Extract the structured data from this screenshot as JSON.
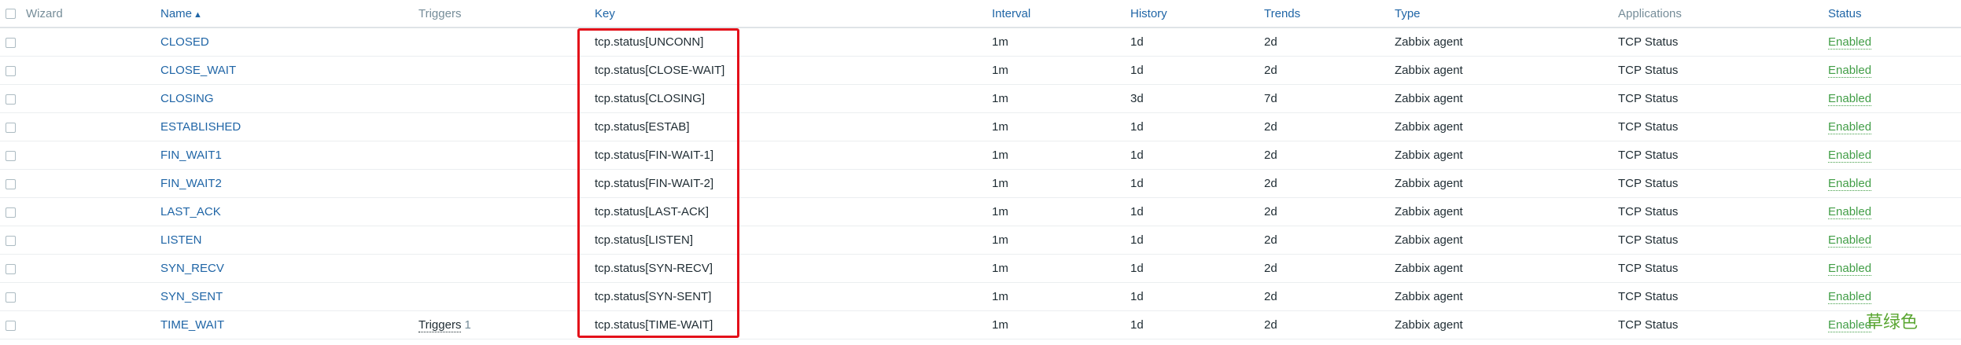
{
  "headers": {
    "wizard": "Wizard",
    "name": "Name",
    "name_sort_indicator": "▲",
    "triggers": "Triggers",
    "key": "Key",
    "interval": "Interval",
    "history": "History",
    "trends": "Trends",
    "type": "Type",
    "applications": "Applications",
    "status": "Status"
  },
  "rows": [
    {
      "name": "CLOSED",
      "triggers": "",
      "triggers_count": "",
      "key": "tcp.status[UNCONN]",
      "interval": "1m",
      "history": "1d",
      "trends": "2d",
      "type": "Zabbix agent",
      "applications": "TCP Status",
      "status": "Enabled"
    },
    {
      "name": "CLOSE_WAIT",
      "triggers": "",
      "triggers_count": "",
      "key": "tcp.status[CLOSE-WAIT]",
      "interval": "1m",
      "history": "1d",
      "trends": "2d",
      "type": "Zabbix agent",
      "applications": "TCP Status",
      "status": "Enabled"
    },
    {
      "name": "CLOSING",
      "triggers": "",
      "triggers_count": "",
      "key": "tcp.status[CLOSING]",
      "interval": "1m",
      "history": "3d",
      "trends": "7d",
      "type": "Zabbix agent",
      "applications": "TCP Status",
      "status": "Enabled"
    },
    {
      "name": "ESTABLISHED",
      "triggers": "",
      "triggers_count": "",
      "key": "tcp.status[ESTAB]",
      "interval": "1m",
      "history": "1d",
      "trends": "2d",
      "type": "Zabbix agent",
      "applications": "TCP Status",
      "status": "Enabled"
    },
    {
      "name": "FIN_WAIT1",
      "triggers": "",
      "triggers_count": "",
      "key": "tcp.status[FIN-WAIT-1]",
      "interval": "1m",
      "history": "1d",
      "trends": "2d",
      "type": "Zabbix agent",
      "applications": "TCP Status",
      "status": "Enabled"
    },
    {
      "name": "FIN_WAIT2",
      "triggers": "",
      "triggers_count": "",
      "key": "tcp.status[FIN-WAIT-2]",
      "interval": "1m",
      "history": "1d",
      "trends": "2d",
      "type": "Zabbix agent",
      "applications": "TCP Status",
      "status": "Enabled"
    },
    {
      "name": "LAST_ACK",
      "triggers": "",
      "triggers_count": "",
      "key": "tcp.status[LAST-ACK]",
      "interval": "1m",
      "history": "1d",
      "trends": "2d",
      "type": "Zabbix agent",
      "applications": "TCP Status",
      "status": "Enabled"
    },
    {
      "name": "LISTEN",
      "triggers": "",
      "triggers_count": "",
      "key": "tcp.status[LISTEN]",
      "interval": "1m",
      "history": "1d",
      "trends": "2d",
      "type": "Zabbix agent",
      "applications": "TCP Status",
      "status": "Enabled"
    },
    {
      "name": "SYN_RECV",
      "triggers": "",
      "triggers_count": "",
      "key": "tcp.status[SYN-RECV]",
      "interval": "1m",
      "history": "1d",
      "trends": "2d",
      "type": "Zabbix agent",
      "applications": "TCP Status",
      "status": "Enabled"
    },
    {
      "name": "SYN_SENT",
      "triggers": "",
      "triggers_count": "",
      "key": "tcp.status[SYN-SENT]",
      "interval": "1m",
      "history": "1d",
      "trends": "2d",
      "type": "Zabbix agent",
      "applications": "TCP Status",
      "status": "Enabled"
    },
    {
      "name": "TIME_WAIT",
      "triggers": "Triggers",
      "triggers_count": "1",
      "key": "tcp.status[TIME-WAIT]",
      "interval": "1m",
      "history": "1d",
      "trends": "2d",
      "type": "Zabbix agent",
      "applications": "TCP Status",
      "status": "Enabled"
    }
  ],
  "watermark": "草绿色",
  "colors": {
    "link": "#1f65a6",
    "status_enabled": "#429e47",
    "highlight": "#e3101a",
    "watermark": "#5aa632"
  }
}
